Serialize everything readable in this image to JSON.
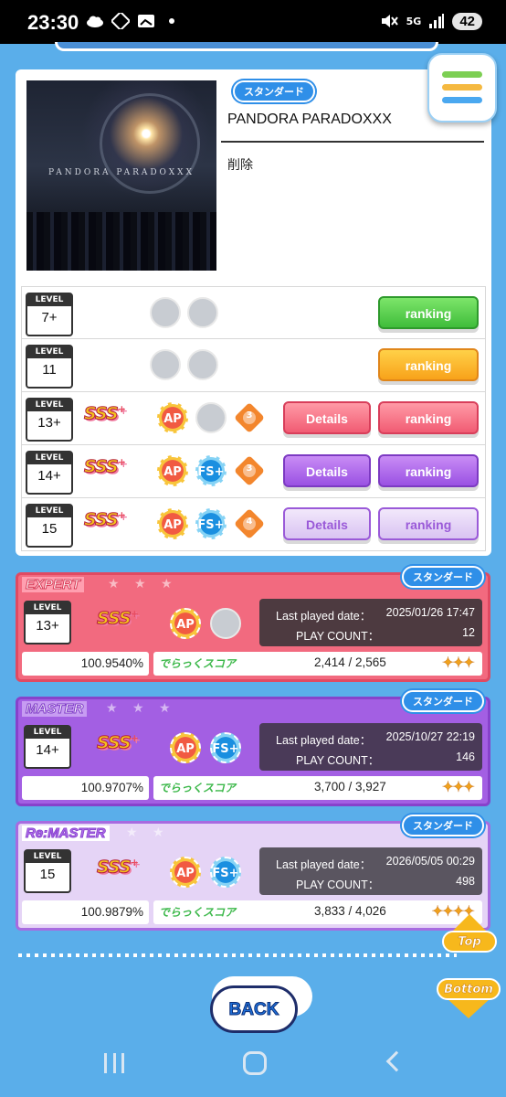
{
  "status_bar": {
    "time": "23:30",
    "network": "5G",
    "battery": "42"
  },
  "song": {
    "tag": "スタンダード",
    "title": "PANDORA PARADOXXX",
    "delete_label": "削除",
    "jacket_text": "PANDORA PARADOXXX"
  },
  "level_rows": [
    {
      "level_caption": "LEVEL",
      "level": "7+",
      "ranking": "ranking"
    },
    {
      "level_caption": "LEVEL",
      "level": "11",
      "ranking": "ranking"
    },
    {
      "level_caption": "LEVEL",
      "level": "13+",
      "rank": "SSS",
      "plus": "+",
      "ap": "AP",
      "medal": "3",
      "details": "Details",
      "ranking": "ranking"
    },
    {
      "level_caption": "LEVEL",
      "level": "14+",
      "rank": "SSS",
      "plus": "+",
      "ap": "AP",
      "fs": "FS+",
      "medal": "3",
      "details": "Details",
      "ranking": "ranking"
    },
    {
      "level_caption": "LEVEL",
      "level": "15",
      "rank": "SSS",
      "plus": "+",
      "ap": "AP",
      "fs": "FS+",
      "medal": "4",
      "details": "Details",
      "ranking": "ranking"
    }
  ],
  "cards": [
    {
      "difficulty": "EXPERT",
      "tag": "スタンダード",
      "stars": "★ ★ ★",
      "level_caption": "LEVEL",
      "level": "13+",
      "rank": "SSS",
      "plus": "+",
      "ap": "AP",
      "last_played_label": "Last played date：",
      "last_played": "2025/01/26 17:47",
      "play_count_label": "PLAY COUNT：",
      "play_count": "12",
      "achievement": "100.9540%",
      "dx_label": "でらっくスコア",
      "dx_score": "2,414 / 2,565",
      "dx_stars": "✦✦✦"
    },
    {
      "difficulty": "MASTER",
      "tag": "スタンダード",
      "stars": "★ ★ ★",
      "level_caption": "LEVEL",
      "level": "14+",
      "rank": "SSS",
      "plus": "+",
      "ap": "AP",
      "fs": "FS+",
      "last_played_label": "Last played date：",
      "last_played": "2025/10/27 22:19",
      "play_count_label": "PLAY COUNT：",
      "play_count": "146",
      "achievement": "100.9707%",
      "dx_label": "でらっくスコア",
      "dx_score": "3,700 / 3,927",
      "dx_stars": "✦✦✦"
    },
    {
      "difficulty": "Re:MASTER",
      "tag": "スタンダード",
      "stars": "★ ★",
      "level_caption": "LEVEL",
      "level": "15",
      "rank": "SSS",
      "plus": "+",
      "ap": "AP",
      "fs": "FS+",
      "last_played_label": "Last played date：",
      "last_played": "2026/05/05 00:29",
      "play_count_label": "PLAY COUNT：",
      "play_count": "498",
      "achievement": "100.9879%",
      "dx_label": "でらっくスコア",
      "dx_score": "3,833 / 4,026",
      "dx_stars": "✦✦✦✦"
    }
  ],
  "nav": {
    "top": "Top",
    "bottom": "Bottom",
    "back": "BACK"
  },
  "colors": {
    "page_bg": "#5aaeea",
    "expert": "#f26a7f",
    "master": "#a35fe3",
    "remaster": "#e5d4f6"
  }
}
